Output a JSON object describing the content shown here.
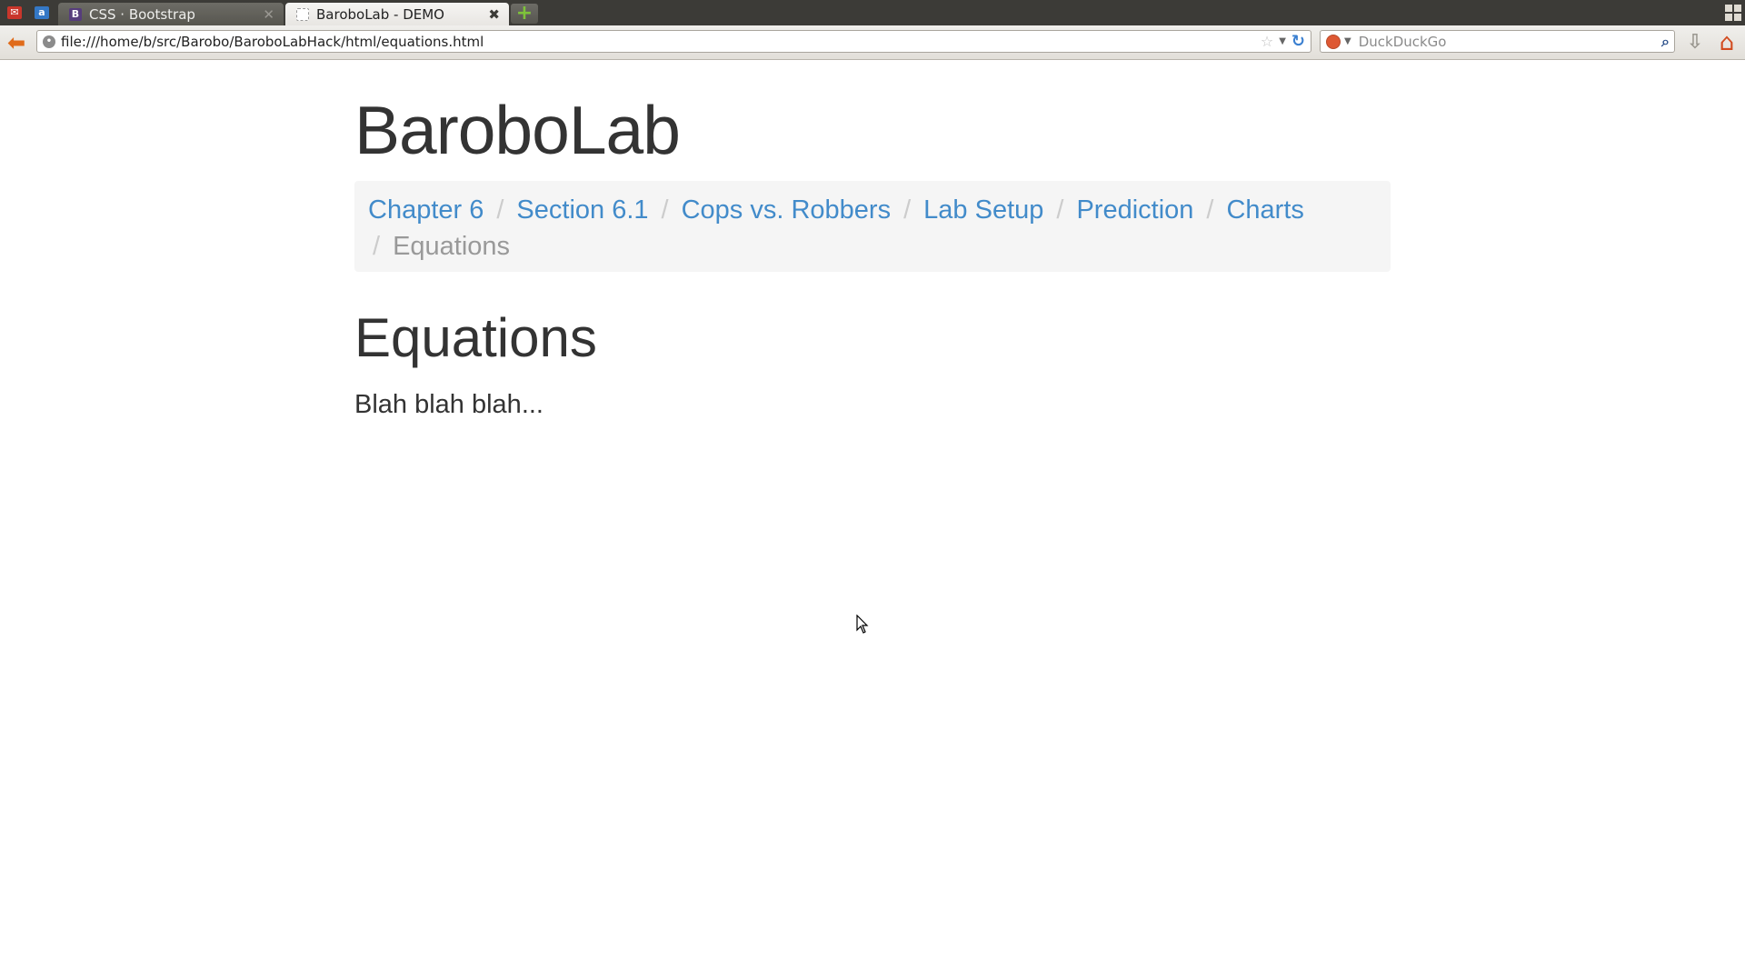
{
  "browser": {
    "tabs": [
      {
        "label": "CSS · Bootstrap",
        "favicon_letter": "B",
        "active": false
      },
      {
        "label": "BaroboLab - DEMO",
        "active": true
      }
    ],
    "url": "file:///home/b/src/Barobo/BaroboLabHack/html/equations.html",
    "search_placeholder": "DuckDuckGo"
  },
  "page": {
    "site_title": "BaroboLab",
    "breadcrumb": [
      {
        "label": "Chapter 6"
      },
      {
        "label": "Section 6.1"
      },
      {
        "label": "Cops vs. Robbers"
      },
      {
        "label": "Lab Setup"
      },
      {
        "label": "Prediction"
      },
      {
        "label": "Charts"
      },
      {
        "label": "Equations",
        "current": true
      }
    ],
    "heading": "Equations",
    "body": "Blah blah blah..."
  },
  "colors": {
    "link": "#428bca",
    "current_crumb": "#999999",
    "breadcrumb_bg": "#f5f5f5",
    "text": "#333333"
  }
}
